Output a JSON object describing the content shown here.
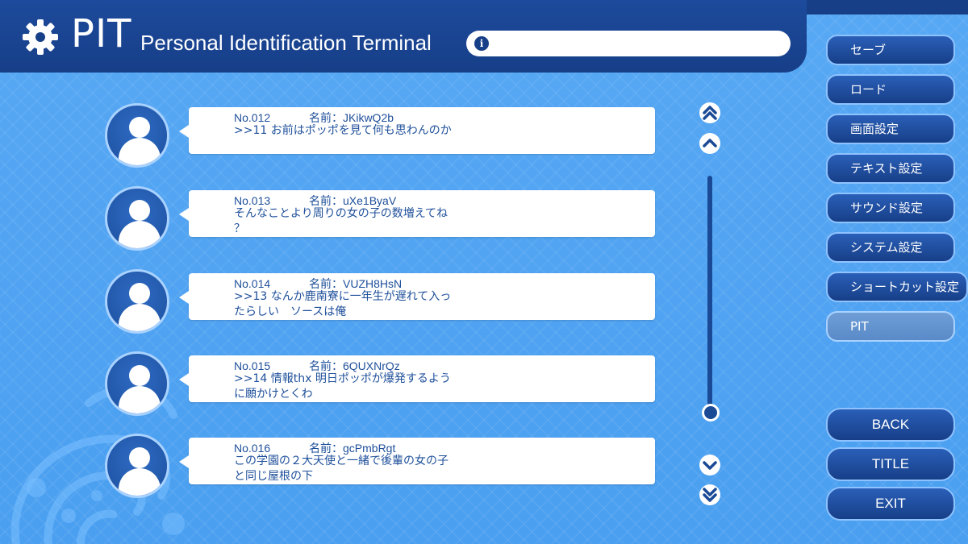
{
  "header": {
    "title": "PIT",
    "subtitle": "Personal Identification Terminal",
    "info_text": ""
  },
  "messages": [
    {
      "no": "No.012",
      "name": "名前：JKikwQ2b",
      "text": ">>11 お前はポッポを見て何も思わんのか"
    },
    {
      "no": "No.013",
      "name": "名前：uXe1ByaV",
      "text": "そんなことより周りの女の子の数増えてね\n？"
    },
    {
      "no": "No.014",
      "name": "名前：VUZH8HsN",
      "text": ">>13 なんか鹿南寮に一年生が遅れて入っ\nたらしい　ソースは俺"
    },
    {
      "no": "No.015",
      "name": "名前：6QUXNrQz",
      "text": ">>14 情報thx 明日ポッポが爆発するよう\nに願かけとくわ"
    },
    {
      "no": "No.016",
      "name": "名前：gcPmbRgt",
      "text": "この学園の２大天使と一緒で後輩の女の子\nと同じ屋根の下"
    }
  ],
  "scroll": {
    "position_fraction": 1.0
  },
  "menu": {
    "items": [
      "セーブ",
      "ロード",
      "画面設定",
      "テキスト設定",
      "サウンド設定",
      "システム設定",
      "ショートカット設定",
      "PIT"
    ],
    "active": "PIT"
  },
  "nav": {
    "back": "BACK",
    "title": "TITLE",
    "exit": "EXIT"
  },
  "icons": {
    "settings": "gear-icon",
    "info": "info-icon",
    "avatar": "user-avatar-icon",
    "scroll_top": "double-chevron-up-icon",
    "scroll_up": "chevron-up-icon",
    "scroll_down": "chevron-down-icon",
    "scroll_bottom": "double-chevron-down-icon"
  },
  "colors": {
    "header": "#173f88",
    "accent": "#1e4f9a",
    "background": "#4a9ff0"
  }
}
